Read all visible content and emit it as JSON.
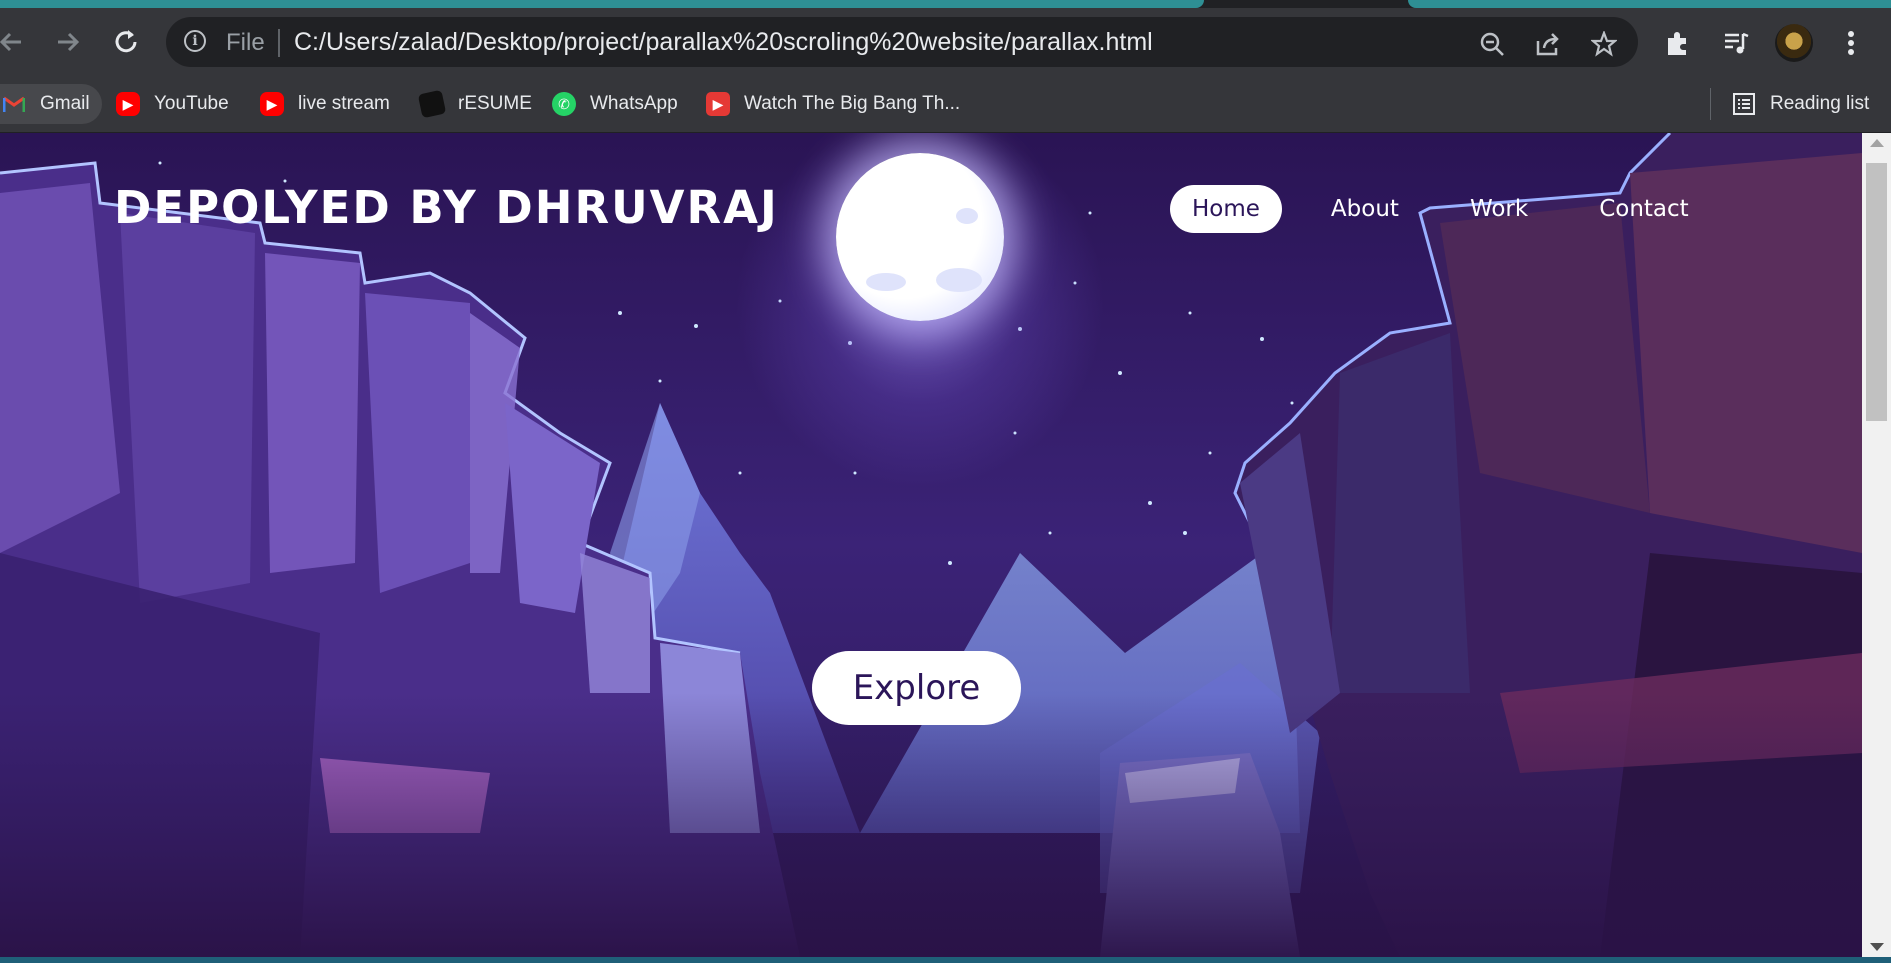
{
  "browser": {
    "omnibox": {
      "scheme_label": "File",
      "url": "C:/Users/zalad/Desktop/project/parallax%20scroling%20website/parallax.html"
    },
    "bookmarks": [
      {
        "label": "Gmail",
        "icon": "gmail-icon"
      },
      {
        "label": "YouTube",
        "icon": "youtube-icon"
      },
      {
        "label": "live stream",
        "icon": "youtube-icon"
      },
      {
        "label": "rESUME",
        "icon": "resume-icon"
      },
      {
        "label": "WhatsApp",
        "icon": "whatsapp-icon"
      },
      {
        "label": "Watch The Big Bang Th...",
        "icon": "play-icon"
      }
    ],
    "reading_list": "Reading list"
  },
  "site": {
    "logo": "DEPOLYED BY DHRUVRAJ",
    "nav": [
      {
        "label": "Home",
        "active": true
      },
      {
        "label": "About",
        "active": false
      },
      {
        "label": "Work",
        "active": false
      },
      {
        "label": "Contact",
        "active": false
      }
    ],
    "cta": "Explore"
  },
  "colors": {
    "accent": "#2e8f94",
    "page_text_dark": "#2b1559",
    "night_sky": "#2a1454"
  }
}
